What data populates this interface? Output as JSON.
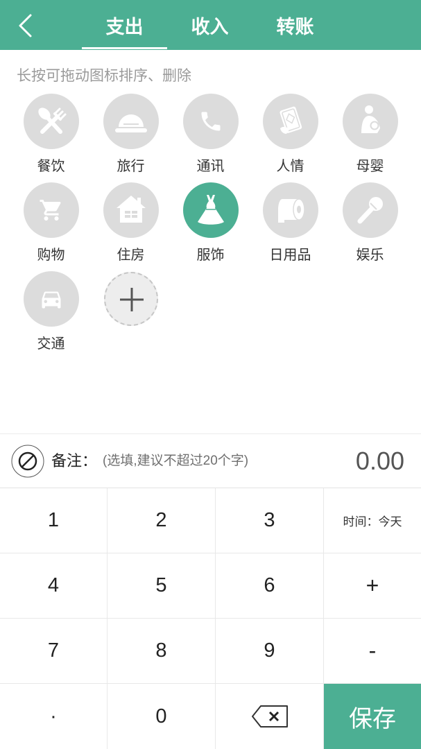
{
  "theme": {
    "accent": "#4CAF93",
    "icon_bg": "#DCDCDC"
  },
  "header": {
    "back_icon": "chevron-left-icon",
    "tabs": [
      {
        "label": "支出",
        "active": true
      },
      {
        "label": "收入",
        "active": false
      },
      {
        "label": "转账",
        "active": false
      }
    ]
  },
  "hint": "长按可拖动图标排序、删除",
  "categories": [
    {
      "label": "餐饮",
      "icon": "utensils-icon",
      "selected": false
    },
    {
      "label": "旅行",
      "icon": "tent-icon",
      "selected": false
    },
    {
      "label": "通讯",
      "icon": "phone-icon",
      "selected": false
    },
    {
      "label": "人情",
      "icon": "red-envelope-icon",
      "selected": false
    },
    {
      "label": "母婴",
      "icon": "mother-baby-icon",
      "selected": false
    },
    {
      "label": "购物",
      "icon": "shopping-cart-icon",
      "selected": false
    },
    {
      "label": "住房",
      "icon": "house-icon",
      "selected": false
    },
    {
      "label": "服饰",
      "icon": "dress-icon",
      "selected": true
    },
    {
      "label": "日用品",
      "icon": "toilet-paper-icon",
      "selected": false
    },
    {
      "label": "娱乐",
      "icon": "microphone-icon",
      "selected": false
    },
    {
      "label": "交通",
      "icon": "car-icon",
      "selected": false
    }
  ],
  "add_category": {
    "icon": "plus-icon"
  },
  "remark": {
    "icon": "ban-icon",
    "label": "备注：",
    "placeholder": "(选填,建议不超过20个字)"
  },
  "amount": "0.00",
  "keypad": {
    "keys": [
      {
        "label": "1"
      },
      {
        "label": "2"
      },
      {
        "label": "3"
      },
      {
        "label": "时间：今天"
      },
      {
        "label": "4"
      },
      {
        "label": "5"
      },
      {
        "label": "6"
      },
      {
        "label": "+"
      },
      {
        "label": "7"
      },
      {
        "label": "8"
      },
      {
        "label": "9"
      },
      {
        "label": "-"
      },
      {
        "label": "·"
      },
      {
        "label": "0"
      },
      {
        "icon": "backspace-icon"
      },
      {
        "label": "保存"
      }
    ]
  }
}
